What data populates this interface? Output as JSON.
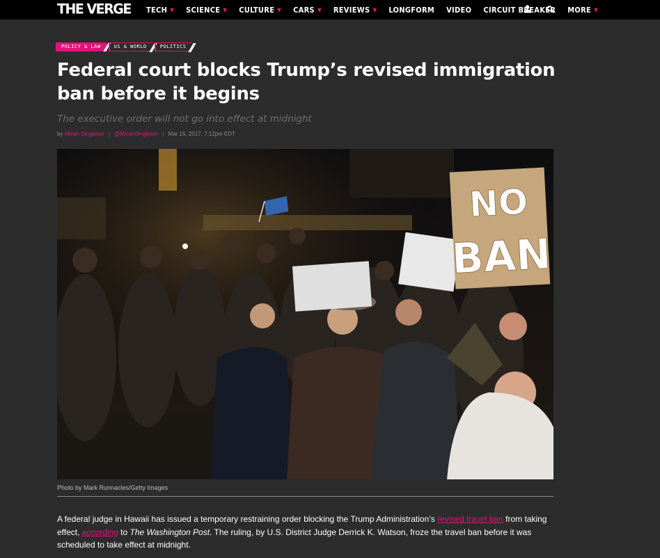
{
  "nav": {
    "logo": "THE VERGE",
    "items": [
      {
        "label": "TECH",
        "caret": true
      },
      {
        "label": "SCIENCE",
        "caret": true
      },
      {
        "label": "CULTURE",
        "caret": true
      },
      {
        "label": "CARS",
        "caret": true
      },
      {
        "label": "REVIEWS",
        "caret": true
      },
      {
        "label": "LONGFORM",
        "caret": false
      },
      {
        "label": "VIDEO",
        "caret": false
      },
      {
        "label": "CIRCUIT BREAKER",
        "caret": false
      },
      {
        "label": "MORE",
        "caret": true
      }
    ],
    "icons": [
      "user-icon",
      "search-icon"
    ],
    "accent": "#e2127a"
  },
  "article": {
    "tags": [
      "POLICY & LAW",
      "US & WORLD",
      "POLITICS"
    ],
    "headline": "Federal court blocks Trump’s revised immigration ban before it begins",
    "subhead": "The executive order will not go into effect at midnight",
    "byline": {
      "prefix": "by",
      "author": "Micah Singleton",
      "handle": "@MicahSingleton",
      "date": "Mar 15, 2017, 7:12pm EDT"
    },
    "photo": {
      "sign_text": "NO BAN",
      "caption": "Photo by Mark Runnacles/Getty Images"
    },
    "body": {
      "p1_a": "A federal judge in Hawaii has issued a temporary restraining order blocking the Trump Administration’s ",
      "link1": "revised travel ban",
      "p1_b": " from taking effect, ",
      "link2": "according",
      "p1_c": " to ",
      "pub": "The Washington Post",
      "p1_d": ". The ruling, by U.S. District Judge Derrick K. Watson, froze the travel ban before it was scheduled to take effect at midnight."
    }
  }
}
